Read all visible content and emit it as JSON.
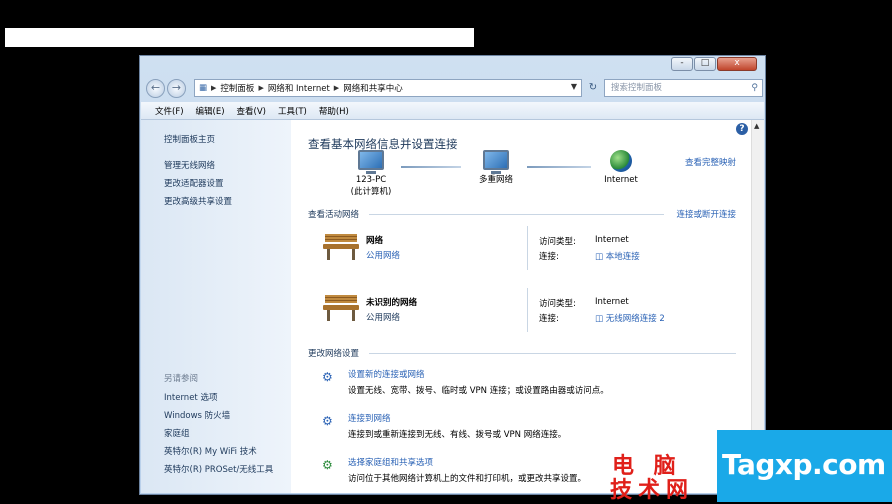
{
  "window": {
    "caption_buttons": [
      "-",
      "□",
      "x"
    ],
    "address": {
      "crumbs": [
        "控制面板",
        "网络和 Internet",
        "网络和共享中心"
      ]
    },
    "search": {
      "placeholder": "搜索控制面板"
    },
    "menu": [
      "文件(F)",
      "编辑(E)",
      "查看(V)",
      "工具(T)",
      "帮助(H)"
    ]
  },
  "sidebar": {
    "home": "控制面板主页",
    "links": [
      "管理无线网络",
      "更改适配器设置",
      "更改高级共享设置"
    ],
    "see_also_header": "另请参阅",
    "see_also": [
      "Internet 选项",
      "Windows 防火墙",
      "家庭组",
      "英特尔(R) My WiFi 技术",
      "英特尔(R) PROSet/无线工具"
    ]
  },
  "main": {
    "title": "查看基本网络信息并设置连接",
    "full_map": "查看完整映射",
    "nodes": {
      "pc_line1": "123-PC",
      "pc_line2": "(此计算机)",
      "mid": "多重网络",
      "internet": "Internet"
    },
    "active_header": "查看活动网络",
    "connect_link": "连接或断开连接",
    "networks": [
      {
        "name": "网络",
        "type": "公用网络",
        "access_label": "访问类型:",
        "access": "Internet",
        "conn_label": "连接:",
        "conn": "本地连接"
      },
      {
        "name": "未识别的网络",
        "type": "公用网络",
        "access_label": "访问类型:",
        "access": "Internet",
        "conn_label": "连接:",
        "conn": "无线网络连接 2"
      }
    ],
    "change_header": "更改网络设置",
    "tasks": [
      {
        "title": "设置新的连接或网络",
        "desc": "设置无线、宽带、拨号、临时或 VPN 连接；或设置路由器或访问点。"
      },
      {
        "title": "连接到网络",
        "desc": "连接到或重新连接到无线、有线、拨号或 VPN 网络连接。"
      },
      {
        "title": "选择家庭组和共享选项",
        "desc": "访问位于其他网络计算机上的文件和打印机，或更改共享设置。"
      }
    ]
  },
  "watermark": {
    "cn_line1": "电 脑",
    "cn_line2": "技术网",
    "site": "Tagxp.com"
  },
  "colors": {
    "link": "#2a62b5",
    "window_frame": "#b9d0ea",
    "watermark_red": "#e0201a",
    "watermark_blue": "#1aa9e8"
  }
}
